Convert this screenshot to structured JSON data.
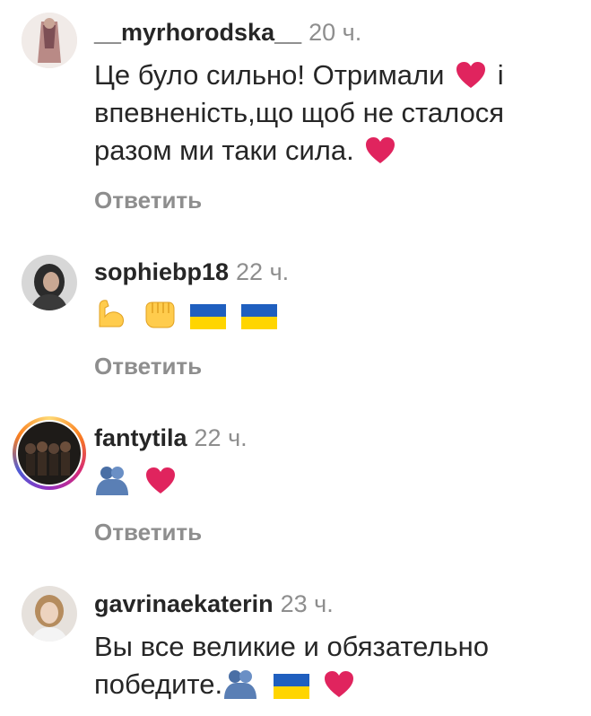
{
  "comments": [
    {
      "username": "__myrhorodska__",
      "time": "20 ч.",
      "text_parts": [
        "Це було сильно! Отримали",
        "і впевненість,що щоб не сталося разом ми таки сила."
      ],
      "emojis": [
        "red-heart",
        "red-heart"
      ],
      "reply": "Ответить"
    },
    {
      "username": "sophiebp18",
      "time": "22 ч.",
      "emojis": [
        "flexed-biceps",
        "oncoming-fist",
        "ukraine-flag",
        "ukraine-flag"
      ],
      "reply": "Ответить"
    },
    {
      "username": "fantytila",
      "time": "22 ч.",
      "emojis": [
        "people-hugging",
        "red-heart"
      ],
      "reply": "Ответить"
    },
    {
      "username": "gavrinaekaterin",
      "time": "23 ч.",
      "text_parts": [
        "Вы все великие и обязательно",
        "победите."
      ],
      "emojis": [
        "people-hugging",
        "ukraine-flag",
        "red-heart"
      ]
    }
  ],
  "colors": {
    "text": "#262626",
    "secondary": "#8e8e8e",
    "heart": "#e0245e",
    "flag_blue": "#1f5fbf",
    "flag_yellow": "#ffd500"
  }
}
